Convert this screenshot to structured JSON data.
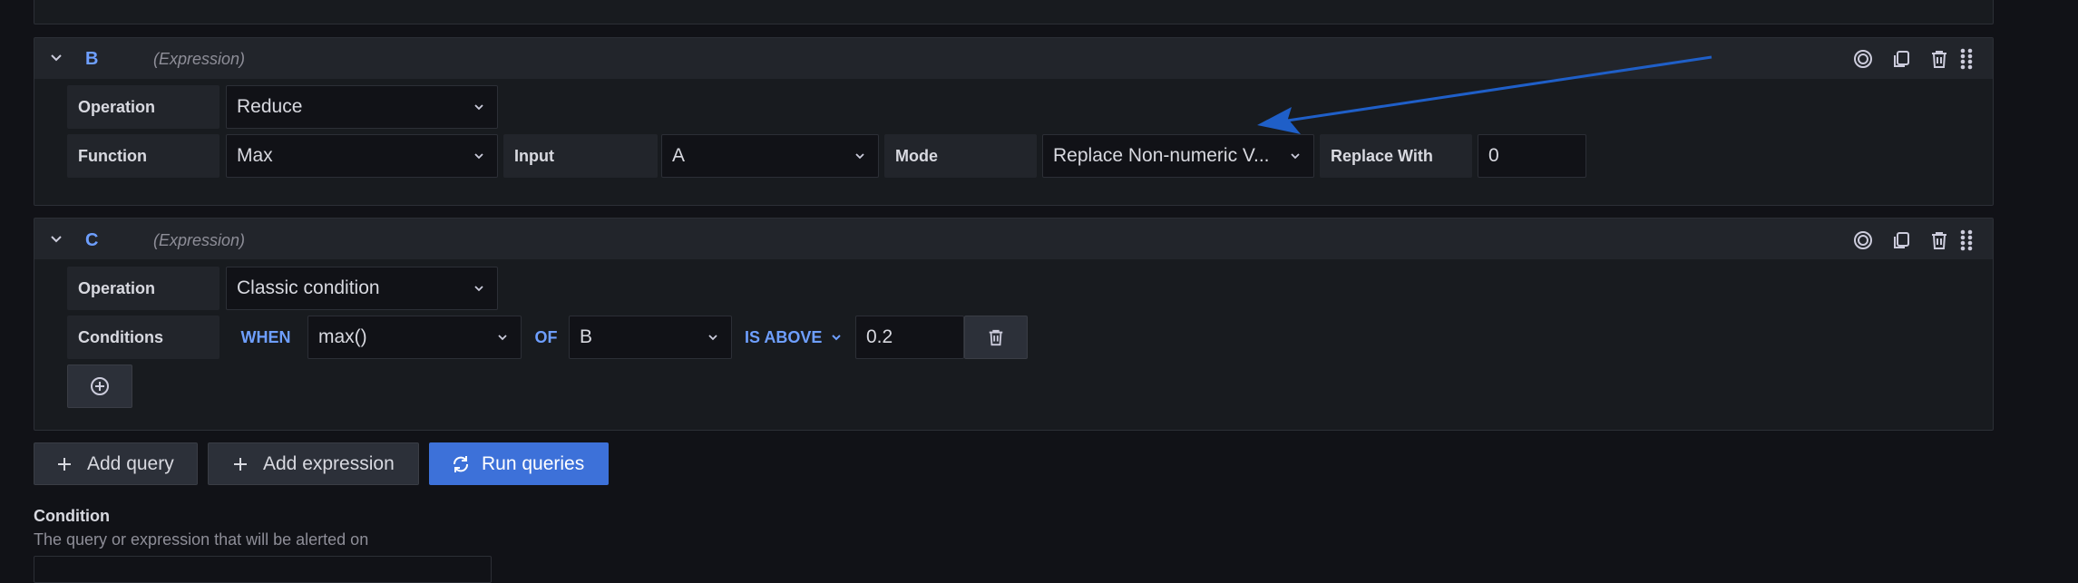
{
  "queries": [
    {
      "ref_id": "B",
      "type_label": "(Expression)",
      "operation_label": "Operation",
      "operation_value": "Reduce",
      "function_label": "Function",
      "function_value": "Max",
      "input_label": "Input",
      "input_value": "A",
      "mode_label": "Mode",
      "mode_value": "Replace Non-numeric V...",
      "replace_with_label": "Replace With",
      "replace_with_value": "0"
    },
    {
      "ref_id": "C",
      "type_label": "(Expression)",
      "operation_label": "Operation",
      "operation_value": "Classic condition",
      "conditions_label": "Conditions",
      "when_keyword": "WHEN",
      "reducer_value": "max()",
      "of_keyword": "OF",
      "query_value": "B",
      "evaluator_value": "IS ABOVE",
      "threshold_value": "0.2"
    }
  ],
  "actions": {
    "add_query": "Add query",
    "add_expression": "Add expression",
    "run_queries": "Run queries"
  },
  "condition": {
    "title": "Condition",
    "description": "The query or expression that will be alerted on"
  },
  "colors": {
    "accent": "#6e9fff",
    "primary_button": "#3d71d9",
    "annotation_arrow": "#1f5fc8",
    "background": "#111217"
  }
}
